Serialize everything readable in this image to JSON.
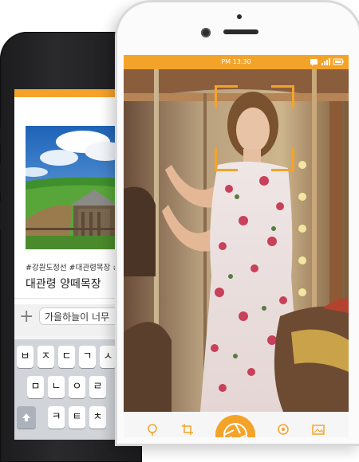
{
  "back_phone": {
    "hashtags": "#강원도정선 #대관령목장 #양",
    "place_title": "대관령 양떼목장",
    "input_value": "가을하늘이 너무",
    "keyboard_row1": [
      "ㅂ",
      "ㅈ",
      "ㄷ",
      "ㄱ",
      "ㅅ"
    ],
    "keyboard_row2": [
      "ㅁ",
      "ㄴ",
      "ㅇ",
      "ㄹ"
    ],
    "keyboard_row3": [
      "ㅋ",
      "ㅌ",
      "ㅊ"
    ]
  },
  "front_phone": {
    "status_time": "PM 13:30",
    "icons": [
      "message-icon",
      "signal-icon",
      "battery-icon"
    ],
    "bottom_icons": [
      "pin-icon",
      "crop-icon",
      "shutter-icon",
      "location-icon",
      "gallery-icon"
    ]
  },
  "colors": {
    "accent": "#f4a32a",
    "back_phone_body": "#1e1e20",
    "front_phone_body": "#fbfbfb"
  }
}
